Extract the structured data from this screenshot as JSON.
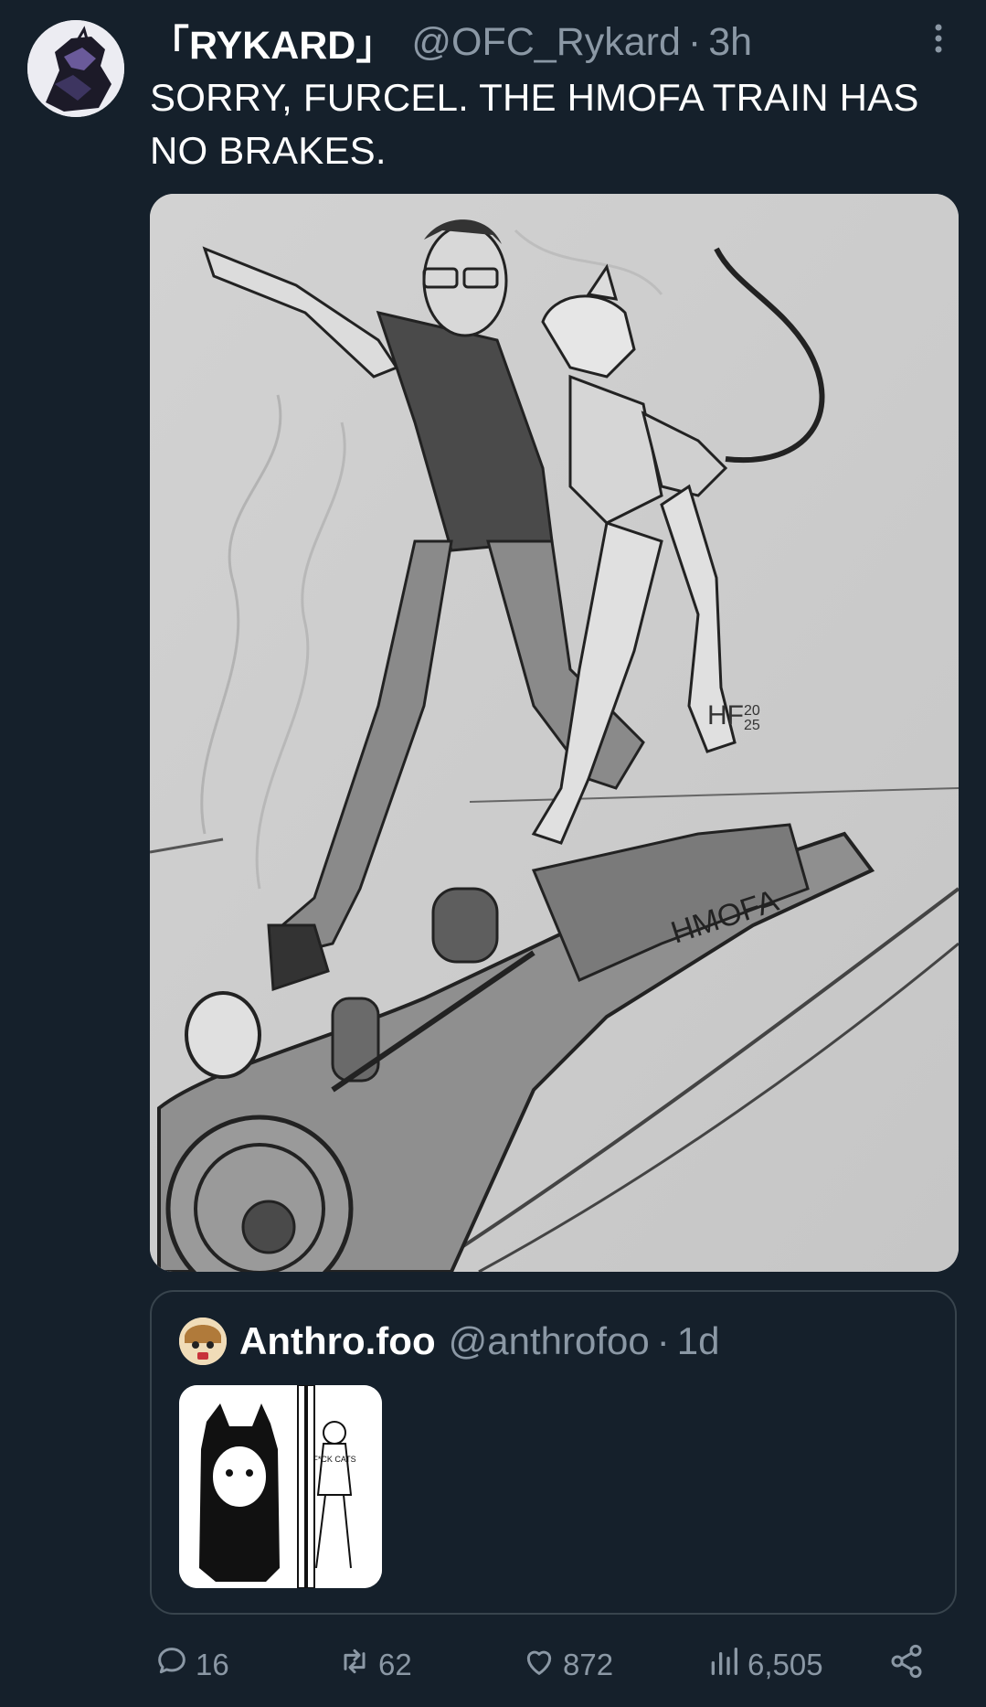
{
  "tweet": {
    "author_name": "「RYKARD」",
    "handle": "@OFC_Rykard",
    "separator": "·",
    "time": "3h",
    "text": "SORRY, FURCEL. THE HMOFA TRAIN HAS NO BRAKES.",
    "more_icon": "more-vertical-icon"
  },
  "media": {
    "signature": "HF",
    "year_top": "20",
    "year_bottom": "25",
    "train_label": "HMOFA"
  },
  "quote": {
    "author_name": "Anthro.foo",
    "handle": "@anthrofoo",
    "separator": "·",
    "time": "1d",
    "shirt_text": "F*CK\nCATS"
  },
  "actions": {
    "replies": "16",
    "retweets": "62",
    "likes": "872",
    "views": "6,505",
    "icons": [
      "reply-icon",
      "retweet-icon",
      "like-icon",
      "views-icon",
      "share-icon"
    ]
  },
  "colors": {
    "background": "#15202b",
    "secondary_text": "#8b98a5",
    "border": "#38444d"
  }
}
